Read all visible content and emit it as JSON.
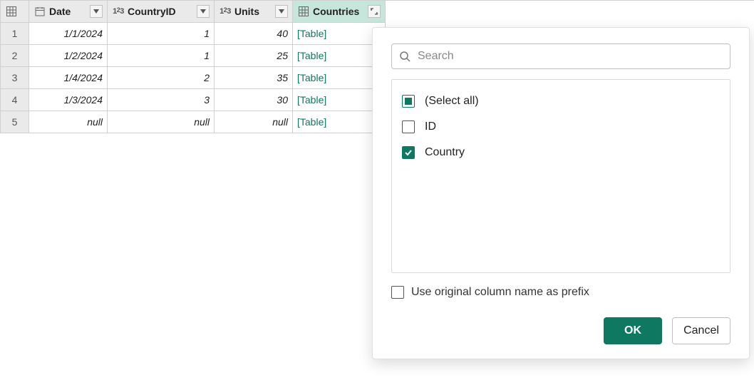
{
  "columns": [
    {
      "name": "Date",
      "type": "date"
    },
    {
      "name": "CountryID",
      "type": "number"
    },
    {
      "name": "Units",
      "type": "number"
    },
    {
      "name": "Countries",
      "type": "table",
      "highlight": true,
      "expand": true
    }
  ],
  "rows": [
    {
      "n": "1",
      "Date": "1/1/2024",
      "CountryID": "1",
      "Units": "40",
      "Countries": "[Table]"
    },
    {
      "n": "2",
      "Date": "1/2/2024",
      "CountryID": "1",
      "Units": "25",
      "Countries": "[Table]"
    },
    {
      "n": "3",
      "Date": "1/4/2024",
      "CountryID": "2",
      "Units": "35",
      "Countries": "[Table]"
    },
    {
      "n": "4",
      "Date": "1/3/2024",
      "CountryID": "3",
      "Units": "30",
      "Countries": "[Table]"
    },
    {
      "n": "5",
      "Date": "null",
      "CountryID": "null",
      "Units": "null",
      "Countries": "[Table]",
      "nullrow": true
    }
  ],
  "panel": {
    "search_placeholder": "Search",
    "options": {
      "select_all": {
        "label": "(Select all)",
        "state": "indeterminate"
      },
      "id": {
        "label": "ID",
        "state": "unchecked"
      },
      "country": {
        "label": "Country",
        "state": "checked"
      }
    },
    "prefix_label": "Use original column name as prefix",
    "prefix_checked": false,
    "ok_label": "OK",
    "cancel_label": "Cancel"
  }
}
